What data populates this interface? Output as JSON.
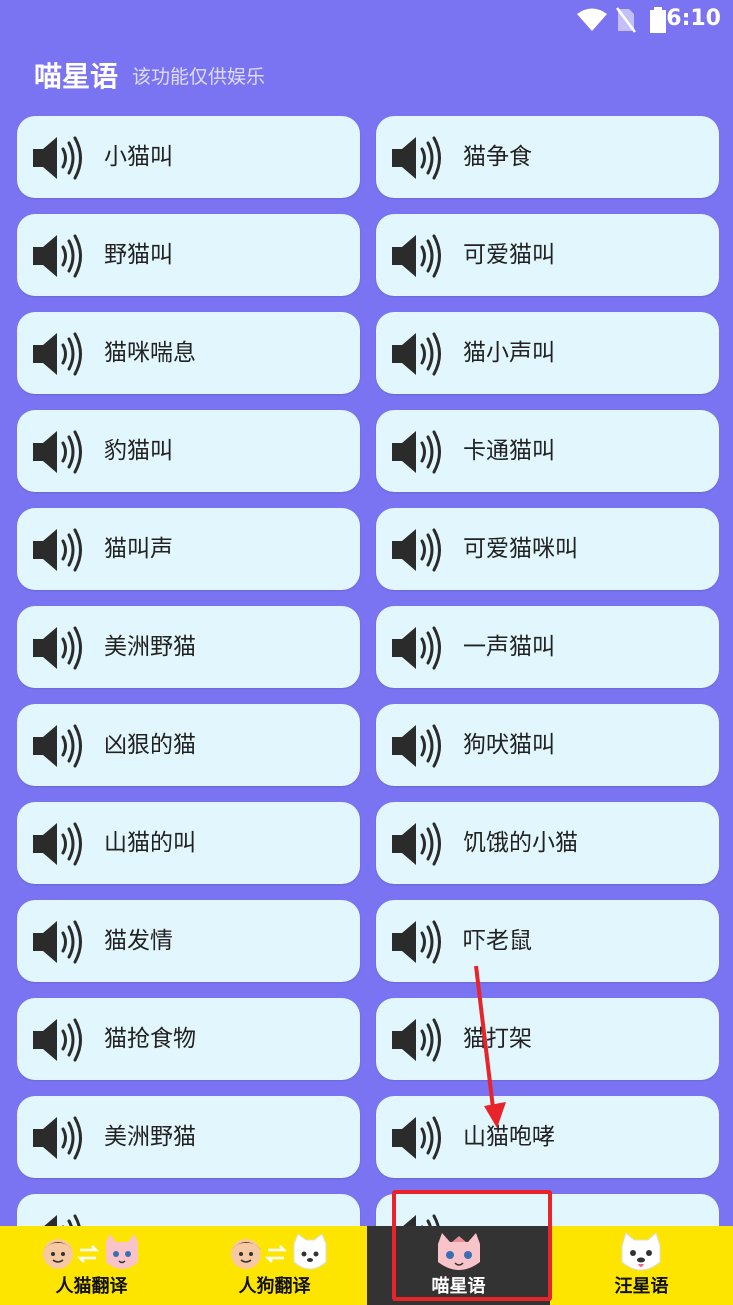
{
  "status_bar": {
    "time": "6:10"
  },
  "header": {
    "title": "喵星语",
    "subtitle": "该功能仅供娱乐"
  },
  "sounds": [
    "小猫叫",
    "猫争食",
    "野猫叫",
    "可爱猫叫",
    "猫咪喘息",
    "猫小声叫",
    "豹猫叫",
    "卡通猫叫",
    "猫叫声",
    "可爱猫咪叫",
    "美洲野猫",
    "一声猫叫",
    "凶狠的猫",
    "狗吠猫叫",
    "山猫的叫",
    "饥饿的小猫",
    "猫发情",
    "吓老鼠",
    "猫抢食物",
    "猫打架",
    "美洲野猫",
    "山猫咆哮",
    "",
    ""
  ],
  "bottom_nav": [
    {
      "label": "人猫翻译",
      "icon": "person-cat-icon",
      "active": false
    },
    {
      "label": "人狗翻译",
      "icon": "person-dog-icon",
      "active": false
    },
    {
      "label": "喵星语",
      "icon": "cat-icon",
      "active": true
    },
    {
      "label": "汪星语",
      "icon": "dog-icon",
      "active": false
    }
  ],
  "annotation_color": "#E8232A"
}
